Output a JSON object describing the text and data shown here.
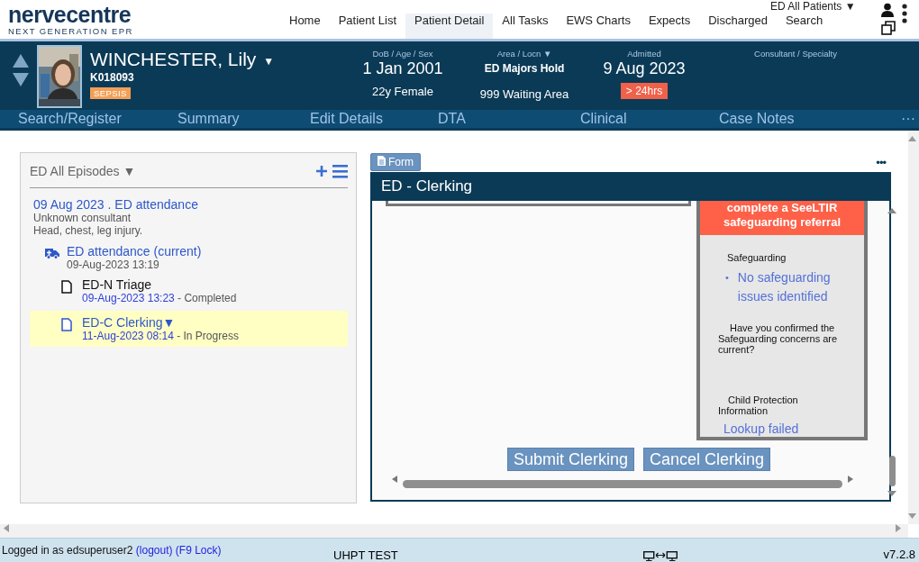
{
  "header": {
    "logo": "nervecentre",
    "tagline": "NEXT GENERATION EPR",
    "list_selector": "ED All Patients ▼",
    "nav": [
      {
        "label": "Home",
        "selected": false
      },
      {
        "label": "Patient List",
        "selected": false
      },
      {
        "label": "Patient Detail",
        "selected": true
      },
      {
        "label": "All Tasks",
        "selected": false
      },
      {
        "label": "EWS Charts",
        "selected": false
      },
      {
        "label": "Expects",
        "selected": false
      },
      {
        "label": "Discharged",
        "selected": false
      },
      {
        "label": "Search",
        "selected": false
      }
    ]
  },
  "patient": {
    "name": "WINCHESTER, Lily",
    "name_caret": "▼",
    "number": "K018093",
    "alert": "SEPSIS",
    "fields": [
      {
        "label": "DoB / Age / Sex",
        "value": "1 Jan 2001",
        "detail": "22y Female"
      },
      {
        "label": "Area / Locn ▼",
        "value": "ED Majors Hold",
        "detail": "999 Waiting Area"
      },
      {
        "label": "Admitted",
        "value": "9 Aug 2023",
        "badge": "> 24hrs"
      },
      {
        "label": "Consultant / Specialty"
      }
    ]
  },
  "tabs": [
    "Search/Register",
    "Summary",
    "Edit Details",
    "DTA",
    "Clinical",
    "Case Notes"
  ],
  "tabs_more": "···",
  "episodes": {
    "title": "ED All Episodes ▼",
    "episode": {
      "heading": "09 Aug 2023 . ED attendance",
      "consultant": "Unknown consultant",
      "complaint": "Head, chest, leg injury.",
      "attendance": {
        "title": "ED attendance (current)",
        "time": "09-Aug-2023 13:19"
      },
      "forms": [
        {
          "title": "ED-N Triage",
          "time": "09-Aug-2023 13:23",
          "status": "- Completed",
          "selected": false
        },
        {
          "title": "ED-C Clerking▼",
          "time": "11-Aug-2023 08:14",
          "status": "- In Progress",
          "selected": true
        }
      ]
    }
  },
  "form": {
    "button": "Form",
    "more": "•••",
    "title": "ED - Clerking",
    "alert_banner": "complete a SeeLTIR safeguarding referral",
    "sections": [
      {
        "kind": "list",
        "label": "Safeguarding",
        "bullet": "•",
        "items": [
          "No safeguarding issues identified"
        ]
      },
      {
        "kind": "question",
        "label": "Have you confirmed the Safeguarding concerns are current?"
      },
      {
        "kind": "link",
        "label": "Child Protection Information",
        "value": "Lookup failed"
      }
    ],
    "buttons": [
      "Submit Clerking",
      "Cancel Clerking"
    ]
  },
  "status_bar": {
    "user": "Logged in as edsuperuser2",
    "logout": "(logout)",
    "lock": "(F9 Lock)",
    "environment": "UHPT TEST",
    "version": "v7.2.8"
  }
}
